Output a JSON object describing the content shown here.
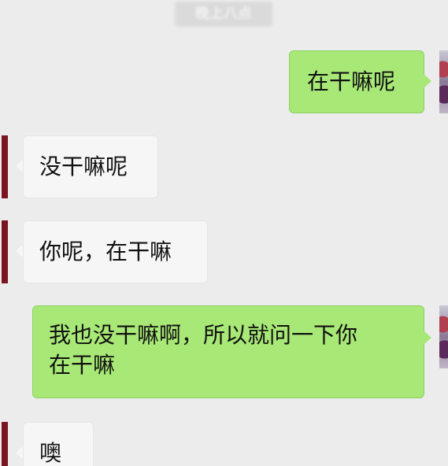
{
  "conversation": {
    "timestamp": "晚上八点",
    "messages": [
      {
        "direction": "outgoing",
        "lines": [
          "在干嘛呢"
        ]
      },
      {
        "direction": "incoming",
        "lines": [
          "没干嘛呢"
        ]
      },
      {
        "direction": "incoming",
        "lines": [
          "你呢，在干嘛"
        ]
      },
      {
        "direction": "outgoing",
        "lines": [
          "我也没干嘛啊，所以就问一下你",
          "在干嘛"
        ]
      },
      {
        "direction": "incoming",
        "lines": [
          "噢"
        ]
      }
    ]
  },
  "colors": {
    "background": "#ececec",
    "outgoing_bubble": "#a8e876",
    "incoming_bubble": "#f6f6f6",
    "incoming_avatar": "#7a1420"
  },
  "icons": {
    "outgoing_avatar": "avatar-image",
    "incoming_avatar": "avatar-image"
  }
}
